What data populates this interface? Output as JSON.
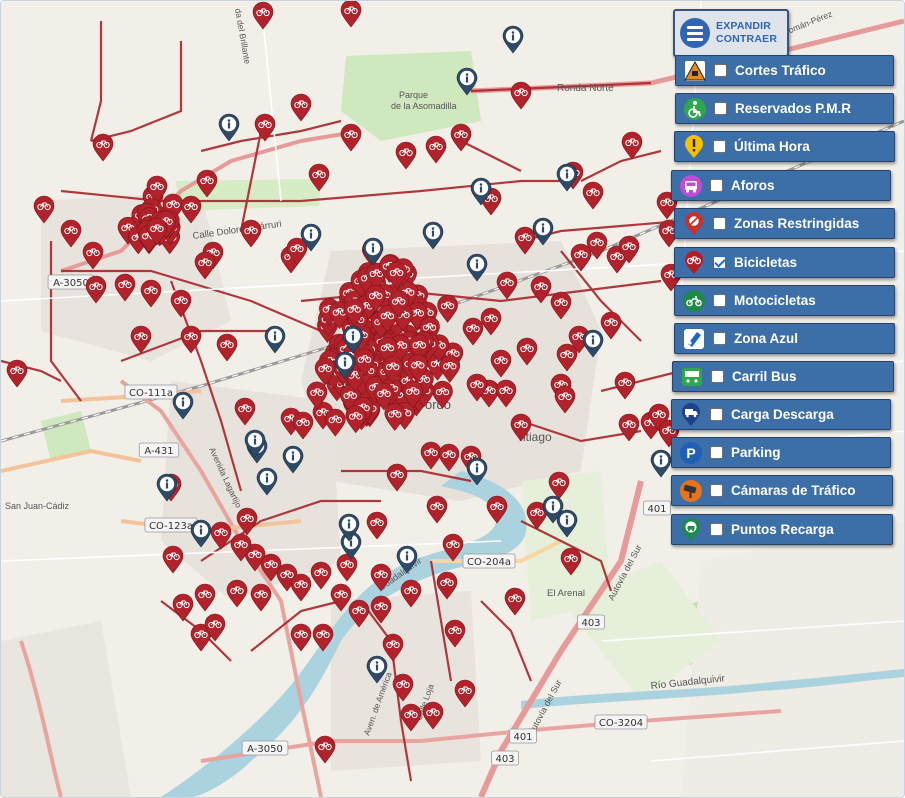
{
  "controls": {
    "expand_line1": "EXPANDIR",
    "expand_line2": "CONTRAER"
  },
  "layers": [
    {
      "label": "Cortes Tráfico",
      "checked": false,
      "icon": "traffic-cut-icon",
      "color": "#e88a1a"
    },
    {
      "label": "Reservados P.M.R",
      "checked": false,
      "icon": "wheelchair-icon",
      "color": "#2ea84a"
    },
    {
      "label": "Última Hora",
      "checked": false,
      "icon": "alert-icon",
      "color": "#f2c200"
    },
    {
      "label": "Aforos",
      "checked": false,
      "icon": "traffic-count-icon",
      "color": "#c04bd4"
    },
    {
      "label": "Zonas Restringidas",
      "checked": false,
      "icon": "restricted-zone-icon",
      "color": "#c9302c"
    },
    {
      "label": "Bicicletas",
      "checked": true,
      "icon": "bicycle-icon",
      "color": "#b71c25"
    },
    {
      "label": "Motocicletas",
      "checked": false,
      "icon": "motorcycle-icon",
      "color": "#1e8a4a"
    },
    {
      "label": "Zona Azul",
      "checked": false,
      "icon": "blue-zone-icon",
      "color": "#1e66c8"
    },
    {
      "label": "Carril Bus",
      "checked": false,
      "icon": "bus-lane-icon",
      "color": "#2ea84a"
    },
    {
      "label": "Carga Descarga",
      "checked": false,
      "icon": "loading-truck-icon",
      "color": "#1f3f8f"
    },
    {
      "label": "Parking",
      "checked": false,
      "icon": "parking-icon",
      "color": "#1f5fb5"
    },
    {
      "label": "Cámaras de Tráfico",
      "checked": false,
      "icon": "traffic-camera-icon",
      "color": "#e8731a"
    },
    {
      "label": "Puntos Recarga",
      "checked": false,
      "icon": "charging-point-icon",
      "color": "#1e8a4a"
    }
  ],
  "map": {
    "labels": {
      "ronda_norte": "Ronda Norte",
      "parque": "Parque",
      "parque2": "de la Asomadilla",
      "dolores": "Calle Dolores Ibárruri",
      "cordoba": "órdo",
      "santiago": "ntiago",
      "san_juan": "San Juan-Cádiz",
      "el_arenal": "El Arenal",
      "guadalquivir": "Río Guadalquivir",
      "guadalquivir2": "Guadalquivir",
      "autovia": "Autovía del Sur",
      "autovia2": "Autovía del Sur",
      "aa_lagartijo": "Avenida Lagartijo",
      "brillante": "da del Brillante",
      "calle_loja": "Calle Loja",
      "av_ame": "Aven. de América",
      "canal": "Canal-Román-Pérez",
      "ronda_oeste": "A-305",
      "shields": [
        "A-3050",
        "CO-111a",
        "A-431",
        "CO-123a",
        "CO-204a",
        "CO-3204",
        "A-3050",
        "401",
        "403",
        "403",
        "401"
      ]
    },
    "bicycle_markers": 300,
    "info_markers": 30
  }
}
